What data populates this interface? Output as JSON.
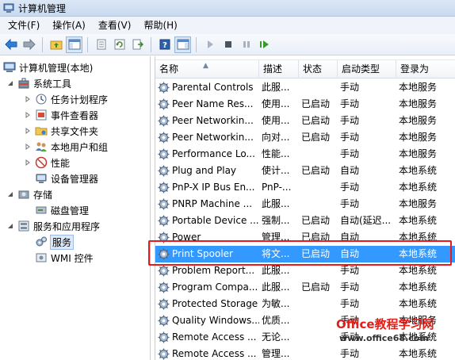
{
  "window": {
    "title": "计算机管理"
  },
  "menu": [
    "文件(F)",
    "操作(A)",
    "查看(V)",
    "帮助(H)"
  ],
  "tree": {
    "root": "计算机管理(本地)",
    "system_tools": "系统工具",
    "task_scheduler": "任务计划程序",
    "event_viewer": "事件查看器",
    "shared_folders": "共享文件夹",
    "local_users": "本地用户和组",
    "performance": "性能",
    "device_manager": "设备管理器",
    "storage": "存储",
    "disk_management": "磁盘管理",
    "services_apps": "服务和应用程序",
    "services": "服务",
    "wmi": "WMI 控件"
  },
  "columns": [
    "名称",
    "描述",
    "状态",
    "启动类型",
    "登录为"
  ],
  "rows": [
    [
      "Parental Controls",
      "此服...",
      "",
      "手动",
      "本地服务"
    ],
    [
      "Peer Name Res...",
      "使用...",
      "已启动",
      "手动",
      "本地服务"
    ],
    [
      "Peer Networkin...",
      "使用...",
      "已启动",
      "手动",
      "本地服务"
    ],
    [
      "Peer Networkin...",
      "向对...",
      "已启动",
      "手动",
      "本地服务"
    ],
    [
      "Performance Lo...",
      "性能...",
      "",
      "手动",
      "本地服务"
    ],
    [
      "Plug and Play",
      "使计...",
      "已启动",
      "自动",
      "本地系统"
    ],
    [
      "PnP-X IP Bus En...",
      "PnP-...",
      "",
      "手动",
      "本地系统"
    ],
    [
      "PNRP Machine ...",
      "此服...",
      "",
      "手动",
      "本地服务"
    ],
    [
      "Portable Device ...",
      "强制...",
      "已启动",
      "自动(延迟...",
      "本地系统"
    ],
    [
      "Power",
      "管理...",
      "已启动",
      "自动",
      "本地系统"
    ],
    [
      "Print Spooler",
      "将文...",
      "已启动",
      "自动",
      "本地系统"
    ],
    [
      "Problem Report...",
      "此服...",
      "",
      "手动",
      "本地系统"
    ],
    [
      "Program Compa...",
      "此服...",
      "已启动",
      "手动",
      "本地系统"
    ],
    [
      "Protected Storage",
      "为敏...",
      "",
      "手动",
      "本地系统"
    ],
    [
      "Quality Windows...",
      "优质...",
      "",
      "手动",
      "本地服务"
    ],
    [
      "Remote Access ...",
      "无论...",
      "",
      "手动",
      "本地系统"
    ],
    [
      "Remote Access ...",
      "管理...",
      "",
      "手动",
      "本地系统"
    ]
  ],
  "selected_row": "Print Spooler",
  "watermark": {
    "logo": "Office教程学习网",
    "url": "www.office68.com"
  },
  "colors": {
    "selection": "#3399ff",
    "highlight": "#e8191f"
  }
}
